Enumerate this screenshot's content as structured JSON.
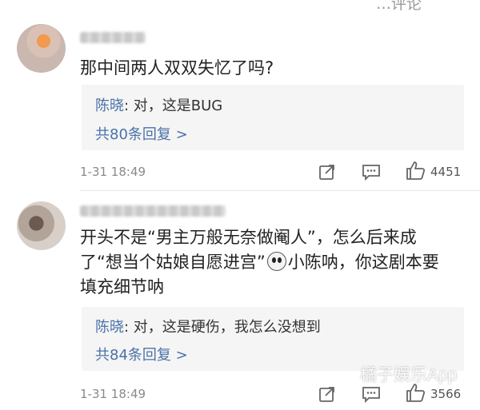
{
  "top_cut_text": "…评论",
  "comments": [
    {
      "text": "那中间两人双双失忆了吗?",
      "reply": {
        "name": "陈晓",
        "text": ": 对，这是BUG"
      },
      "more_replies": "共80条回复 >",
      "time": "1-31 18:49",
      "likes": "4451"
    },
    {
      "text_line1": "开头不是“男主万般无奈做阉人”，怎么后来成",
      "text_line2a": "了“想当个姑娘自愿进宫”",
      "text_line2b": "小陈呐，你这剧本要",
      "text_line3": "填充细节呐",
      "reply": {
        "name": "陈晓",
        "text": ": 对，这是硬伤，我怎么没想到"
      },
      "more_replies": "共84条回复 >",
      "time": "1-31 18:49",
      "likes": "3566"
    }
  ],
  "watermark": "橘子娱乐App",
  "icons": [
    "share-icon",
    "comment-icon",
    "like-icon",
    "emoji-icon"
  ]
}
